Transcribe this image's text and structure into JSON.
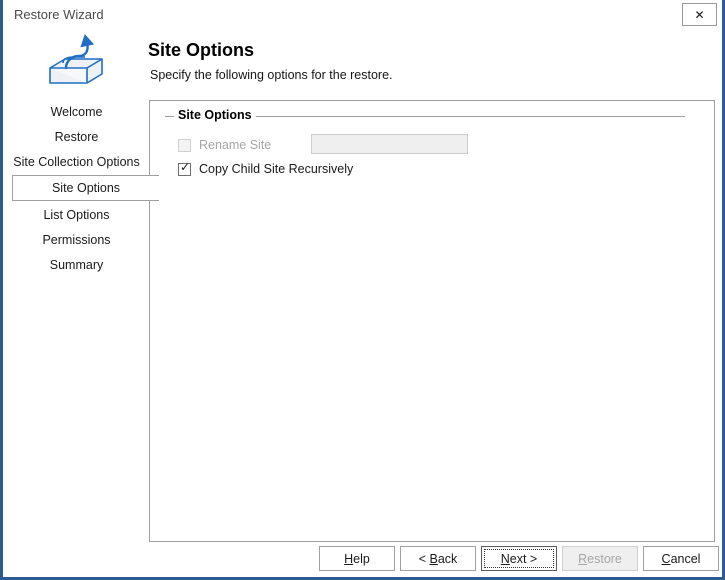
{
  "window": {
    "title": "Restore Wizard",
    "close_label": "✕",
    "border_color": "#2c5a91"
  },
  "header": {
    "icon": "restore-box-arrow-icon",
    "title": "Site Options",
    "subtitle": "Specify the following options for the restore."
  },
  "sidebar": {
    "items": [
      {
        "label": "Welcome",
        "selected": false
      },
      {
        "label": "Restore",
        "selected": false
      },
      {
        "label": "Site Collection Options",
        "selected": false
      },
      {
        "label": "Site Options",
        "selected": true
      },
      {
        "label": "List Options",
        "selected": false
      },
      {
        "label": "Permissions",
        "selected": false
      },
      {
        "label": "Summary",
        "selected": false
      }
    ]
  },
  "main": {
    "group": {
      "legend": "Site Options",
      "rename_site": {
        "label": "Rename Site",
        "checked": false,
        "disabled": true
      },
      "rename_input": {
        "value": "",
        "placeholder": "",
        "disabled": true
      },
      "copy_child_site": {
        "label": "Copy Child Site Recursively",
        "checked": true,
        "disabled": false,
        "check_glyph": "✓"
      }
    }
  },
  "footer": {
    "buttons": [
      {
        "name": "help",
        "pre": "",
        "accel": "H",
        "post": "elp",
        "state": "normal"
      },
      {
        "name": "back",
        "pre": "< ",
        "accel": "B",
        "post": "ack",
        "state": "normal"
      },
      {
        "name": "next",
        "pre": "",
        "accel": "N",
        "post": "ext >",
        "state": "focused"
      },
      {
        "name": "restore",
        "pre": "",
        "accel": "R",
        "post": "estore",
        "state": "disabled"
      },
      {
        "name": "cancel",
        "pre": "",
        "accel": "C",
        "post": "ancel",
        "state": "normal"
      }
    ]
  }
}
